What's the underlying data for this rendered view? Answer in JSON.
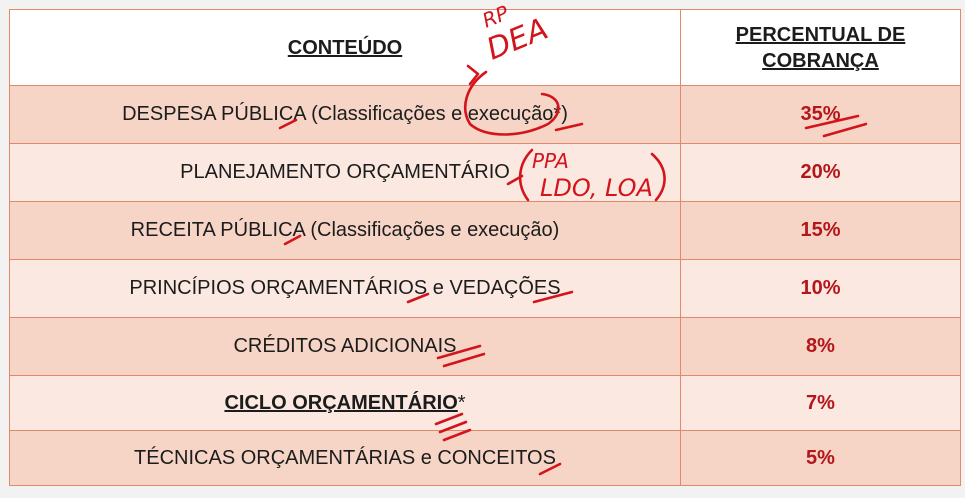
{
  "table": {
    "header": {
      "content": "CONTEÚDO",
      "percent_line1": "PERCENTUAL DE",
      "percent_line2": "COBRANÇA"
    },
    "rows": [
      {
        "content": "DESPESA PÚBLICA (Classificações e execução*)",
        "percent": "35%"
      },
      {
        "content": "PLANEJAMENTO ORÇAMENTÁRIO",
        "percent": "20%"
      },
      {
        "content": "RECEITA PÚBLICA (Classificações e execução)",
        "percent": "15%"
      },
      {
        "content": "PRINCÍPIOS ORÇAMENTÁRIOS e VEDAÇÕES",
        "percent": "10%"
      },
      {
        "content": "CRÉDITOS ADICIONAIS",
        "percent": "8%"
      },
      {
        "content_bold": "CICLO ORÇAMENTÁRIO",
        "content_suffix": "*",
        "percent": "7%"
      },
      {
        "content": "TÉCNICAS ORÇAMENTÁRIAS e CONCEITOS",
        "percent": "5%"
      }
    ]
  },
  "annotations": {
    "note_rp": "RP",
    "note_dea": "DEA",
    "note_ppa": "PPA",
    "note_ldo_loa": "LDO, LOA",
    "ink_color": "#d4141c"
  },
  "colors": {
    "border": "#e08a6b",
    "row_dark": "#f6d5c6",
    "row_light": "#fbe9e1",
    "percent_text": "#b3161b"
  }
}
